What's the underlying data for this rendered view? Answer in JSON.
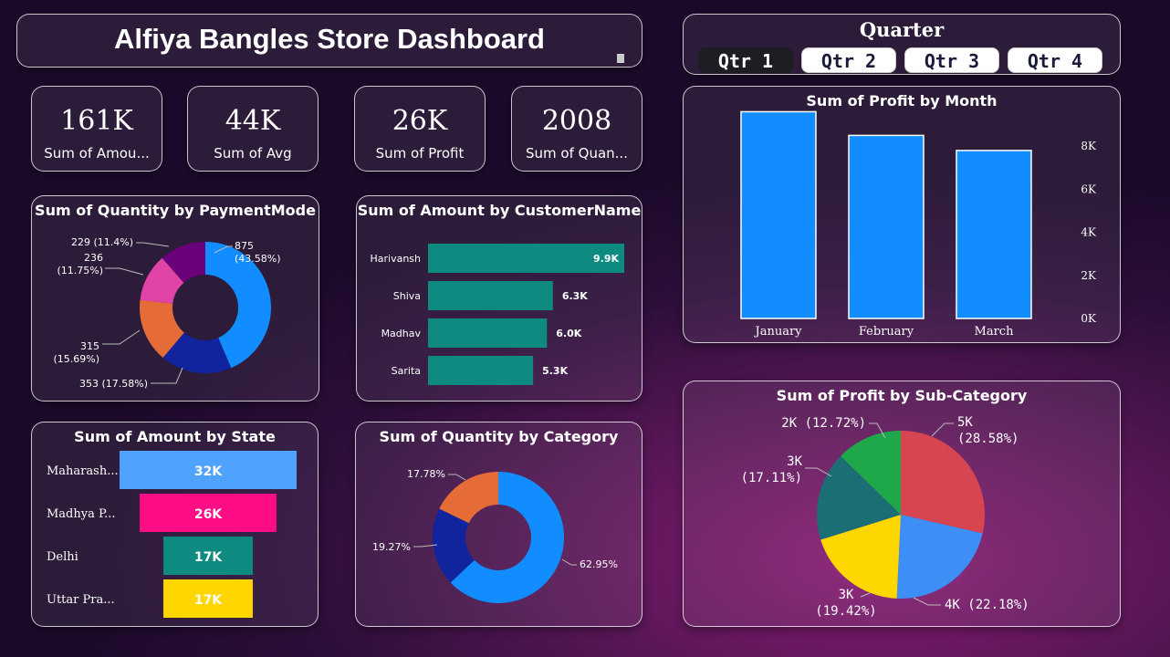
{
  "header": {
    "title": "Alfiya Bangles Store Dashboard"
  },
  "kpis": [
    {
      "value": "161K",
      "label": "Sum of Amou..."
    },
    {
      "value": "44K",
      "label": "Sum of Avg"
    },
    {
      "value": "26K",
      "label": "Sum of Profit"
    },
    {
      "value": "2008",
      "label": "Sum of Quan..."
    }
  ],
  "quarter": {
    "title": "Quarter",
    "options": [
      "Qtr 1",
      "Qtr 2",
      "Qtr 3",
      "Qtr 4"
    ],
    "selected": "Qtr 1"
  },
  "colors": {
    "blue": "#118DFF",
    "navy": "#12239E",
    "orange": "#E66C37",
    "pink": "#E044A7",
    "purple": "#6B007B",
    "teal": "#0E8A80",
    "state_blue": "#4FA3FF",
    "state_pink": "#FF0D85",
    "yellow": "#FFD600",
    "pie_red": "#D64550",
    "pie_blue": "#3D8EF5",
    "pie_yellow": "#FFD700",
    "pie_teal": "#1A6E74",
    "pie_green": "#1EA84A"
  },
  "chart_data": [
    {
      "type": "pie",
      "title": "Sum of Quantity by PaymentMode",
      "values": [
        875,
        353,
        315,
        236,
        229
      ],
      "data_labels": [
        "875\n(43.58%)",
        "353 (17.58%)",
        "315\n(15.69%)",
        "236\n(11.75%)",
        "229 (11.4%)"
      ]
    },
    {
      "type": "bar",
      "title": "Sum of Amount by CustomerName",
      "categories": [
        "Harivansh",
        "Shiva",
        "Madhav",
        "Sarita"
      ],
      "values": [
        9.9,
        6.3,
        6.0,
        5.3
      ],
      "data_labels": [
        "9.9K",
        "6.3K",
        "6.0K",
        "5.3K"
      ]
    },
    {
      "type": "bar",
      "title": "Sum of Profit by Month",
      "categories": [
        "January",
        "February",
        "March"
      ],
      "values": [
        9.6,
        8.5,
        7.8
      ],
      "yticks": [
        "0K",
        "2K",
        "4K",
        "6K",
        "8K"
      ],
      "ylim": [
        0,
        10
      ]
    },
    {
      "type": "bar",
      "title": "Sum of Amount by State",
      "categories": [
        "Maharash...",
        "Madhya P...",
        "Delhi",
        "Uttar Pra..."
      ],
      "values": [
        32,
        26,
        17,
        17
      ],
      "data_labels": [
        "32K",
        "26K",
        "17K",
        "17K"
      ]
    },
    {
      "type": "pie",
      "title": "Sum of Quantity by Category",
      "values": [
        62.95,
        19.27,
        17.78
      ],
      "data_labels": [
        "62.95%",
        "19.27%",
        "17.78%"
      ]
    },
    {
      "type": "pie",
      "title": "Sum of Profit by Sub-Category",
      "values": [
        28.58,
        22.18,
        19.42,
        17.11,
        12.72
      ],
      "data_labels": [
        "5K\n(28.58%)",
        "4K (22.18%)",
        "3K\n(19.42%)",
        "3K\n(17.11%)",
        "2K (12.72%)"
      ]
    }
  ]
}
